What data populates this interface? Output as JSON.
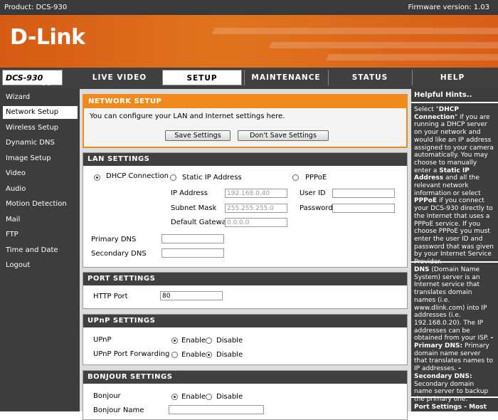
{
  "header": {
    "product": "Product: DCS-930",
    "firmware": "Firmware version: 1.03",
    "logo": "D-Link"
  },
  "nav": {
    "model": "DCS-930",
    "tabs": [
      "LIVE VIDEO",
      "SETUP",
      "MAINTENANCE",
      "STATUS",
      "HELP"
    ],
    "selected_tab": "SETUP"
  },
  "sidebar": {
    "items": [
      "Wizard",
      "Network Setup",
      "Wireless Setup",
      "Dynamic DNS",
      "Image Setup",
      "Video",
      "Audio",
      "Motion Detection",
      "Mail",
      "FTP",
      "Time and Date",
      "Logout"
    ],
    "selected": "Network Setup"
  },
  "network_setup": {
    "title": "NETWORK SETUP",
    "description": "You can configure your LAN and Internet settings here.",
    "save_label": "Save Settings",
    "dont_save_label": "Don't Save Settings"
  },
  "lan": {
    "title": "LAN SETTINGS",
    "dhcp_label": "DHCP Connection",
    "static_label": "Static IP Address",
    "pppoe_label": "PPPoE",
    "selected_mode": "DHCP Connection",
    "ip_label": "IP Address",
    "ip_value": "192.168.0.40",
    "subnet_label": "Subnet Mask",
    "subnet_value": "255.255.255.0",
    "gateway_label": "Default Gateway",
    "gateway_value": "0.0.0.0",
    "userid_label": "User ID",
    "userid_value": "",
    "password_label": "Password",
    "password_value": "",
    "primary_dns_label": "Primary DNS",
    "primary_dns_value": "",
    "secondary_dns_label": "Secondary DNS",
    "secondary_dns_value": ""
  },
  "port": {
    "title": "PORT SETTINGS",
    "http_label": "HTTP Port",
    "http_value": "80"
  },
  "upnp": {
    "title": "UPnP SETTINGS",
    "upnp_label": "UPnP",
    "forward_label": "UPnP Port Forwarding",
    "enable": "Enable",
    "disable": "Disable",
    "upnp_state": "Enable",
    "forward_state": "Disable"
  },
  "bonjour": {
    "title": "BONJOUR SETTINGS",
    "bonjour_label": "Bonjour",
    "bonjour_state": "Enable",
    "name_label": "Bonjour Name",
    "name_value": "",
    "enable": "Enable",
    "disable": "Disable"
  },
  "hints": {
    "title": "Helpful Hints..",
    "p1_pre": "Select \"",
    "p1_b1": "DHCP Connection",
    "p1_mid1": "\" if you are running a DHCP server on your network and would like an IP address assigned to your camera automatically. You may choose to manually enter a ",
    "p1_b2": "Static IP Address",
    "p1_mid2": " and all the relevant network information or select ",
    "p1_b3": "PPPoE",
    "p1_post": " if you connect your DCS-930 directly to the Internet that uses a PPPoE service. If you choose PPPoE you must enter the user ID and password that was given by your Internet Service Provider.",
    "p2_b1": "DNS",
    "p2_mid1": " (Domain Name System) server is an Internet service that translates domain names (i.e. www.dlink.com) into IP addresses (i.e. 192.168.0.20). The IP addresses can be obtained from your ISP.",
    "p2_b2": "- Primary DNS:",
    "p2_mid2": " Primary domain name server that translates names to IP addresses.",
    "p2_b3": "- Secondary DNS:",
    "p2_post": " Secondary domain name server to backup the primary one.",
    "p3": "Port Settings - Most"
  }
}
